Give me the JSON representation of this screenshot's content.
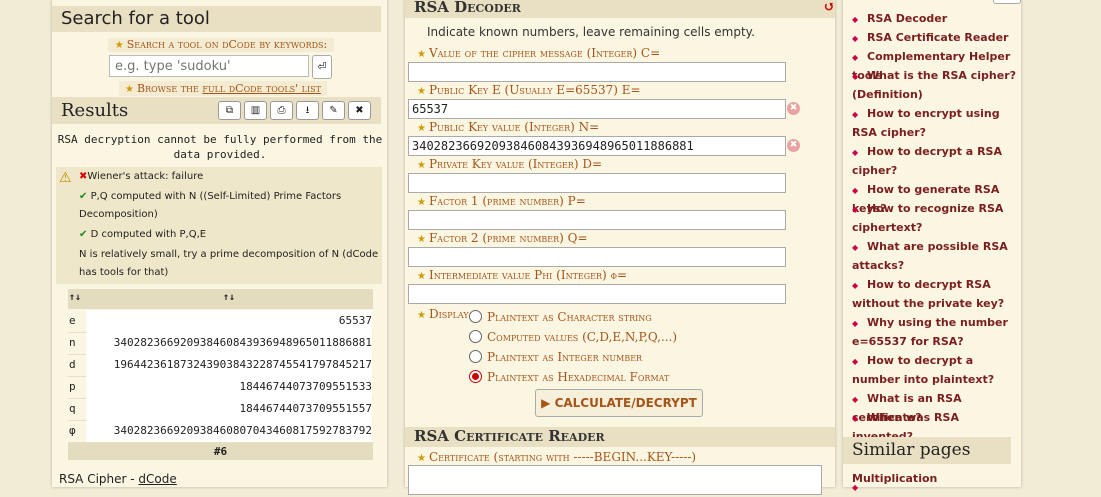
{
  "left": {
    "search_title": "Search for a tool",
    "search_label": "Search a tool on dCode by keywords:",
    "search_placeholder": "e.g. type 'sudoku'",
    "search_go": "⏎",
    "browse_prefix": "Browse the ",
    "browse_link": "full dCode tools' list",
    "results_title": "Results",
    "results_buttons": [
      "⧉",
      "▥",
      "⎙",
      "⭳",
      "✎",
      "✖"
    ],
    "message": "RSA decryption cannot be fully performed from the data provided.",
    "log": [
      {
        "mark": "✖",
        "text": "Wiener's attack: failure"
      },
      {
        "mark": "✔",
        "text": "P,Q computed with N ((Self-Limited) Prime Factors Decomposition)"
      },
      {
        "mark": "✔",
        "text": "D computed with P,Q,E"
      },
      {
        "mark": "",
        "text": "N is relatively small, try a prime decomposition of N (dCode has tools for that)"
      }
    ],
    "table_header": [
      "↑↓",
      "↑↓"
    ],
    "table_rows": [
      {
        "k": "e",
        "v": "65537"
      },
      {
        "k": "n",
        "v": "340282366920938460843936948965011886881"
      },
      {
        "k": "d",
        "v": "196442361873243903843228745541797845217"
      },
      {
        "k": "p",
        "v": "18446744073709551533"
      },
      {
        "k": "q",
        "v": "18446744073709551557"
      },
      {
        "k": "φ",
        "v": "340282366920938460807043460817592783792"
      }
    ],
    "table_footer": "#6",
    "credit_prefix": "RSA Cipher - ",
    "credit_link": "dCode"
  },
  "center": {
    "title": "RSA Decoder",
    "reset_icon": "↺",
    "hint": "Indicate known numbers, leave remaining cells empty.",
    "fields": [
      {
        "label": "Value of the cipher message (Integer) C=",
        "value": ""
      },
      {
        "label": "Public Key E (Usually E=65537) E=",
        "value": "65537"
      },
      {
        "label": "Public Key value (Integer) N=",
        "value": "340282366920938460843936948965011886881"
      },
      {
        "label": "Private Key value (Integer) D=",
        "value": ""
      },
      {
        "label": "Factor 1 (prime number) P=",
        "value": ""
      },
      {
        "label": "Factor 2 (prime number) Q=",
        "value": ""
      },
      {
        "label": "Intermediate value Phi (Integer) φ=",
        "value": ""
      }
    ],
    "display_label": "Display",
    "display_options": [
      {
        "label": "Plaintext as Character string",
        "checked": false
      },
      {
        "label": "Computed values (C,D,E,N,P,Q,...)",
        "checked": false
      },
      {
        "label": "Plaintext as Integer number",
        "checked": false
      },
      {
        "label": "Plaintext as Hexadecimal Format",
        "checked": true
      }
    ],
    "calc_button": "▶ CALCULATE/DECRYPT",
    "cert_title": "RSA Certificate Reader",
    "cert_label": "Certificate (starting with -----BEGIN...KEY-----)"
  },
  "right": {
    "nav_items": [
      "RSA Decoder",
      "RSA Certificate Reader",
      "Complementary Helper tools",
      "What is the RSA cipher? (Definition)",
      "How to encrypt using RSA cipher?",
      "How to decrypt a RSA cipher?",
      "How to generate RSA keys?",
      "How to recognize RSA ciphertext?",
      "What are possible RSA attacks?",
      "How to decrypt RSA without the private key?",
      "Why using the number e=65537 for RSA?",
      "How to decrypt a number into plaintext?",
      "What is an RSA certificate?",
      "When was RSA invented?"
    ],
    "similar_title": "Similar pages",
    "similar_items": [
      "Multiplication"
    ]
  }
}
